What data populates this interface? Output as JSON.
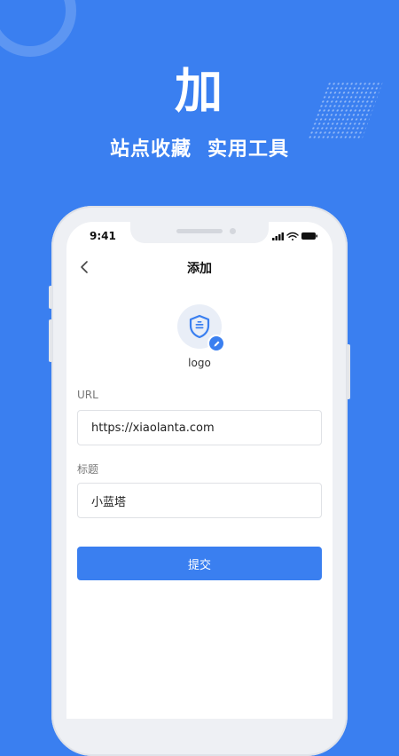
{
  "hero": {
    "char": "加",
    "subtitle_left": "站点收藏",
    "subtitle_right": "实用工具"
  },
  "status_bar": {
    "time": "9:41",
    "icons": [
      "signal-icon",
      "wifi-icon",
      "battery-icon"
    ]
  },
  "nav": {
    "title": "添加",
    "back_icon": "chevron-left-icon"
  },
  "logo": {
    "icon": "shield-icon",
    "edit_icon": "pencil-icon",
    "caption": "logo"
  },
  "form": {
    "url_label": "URL",
    "url_value": "https://xiaolanta.com",
    "title_label": "标题",
    "title_value": "小蓝塔",
    "submit_label": "提交"
  },
  "colors": {
    "background": "#3a7ff0",
    "accent": "#3a7ff0",
    "screen": "#ffffff"
  }
}
